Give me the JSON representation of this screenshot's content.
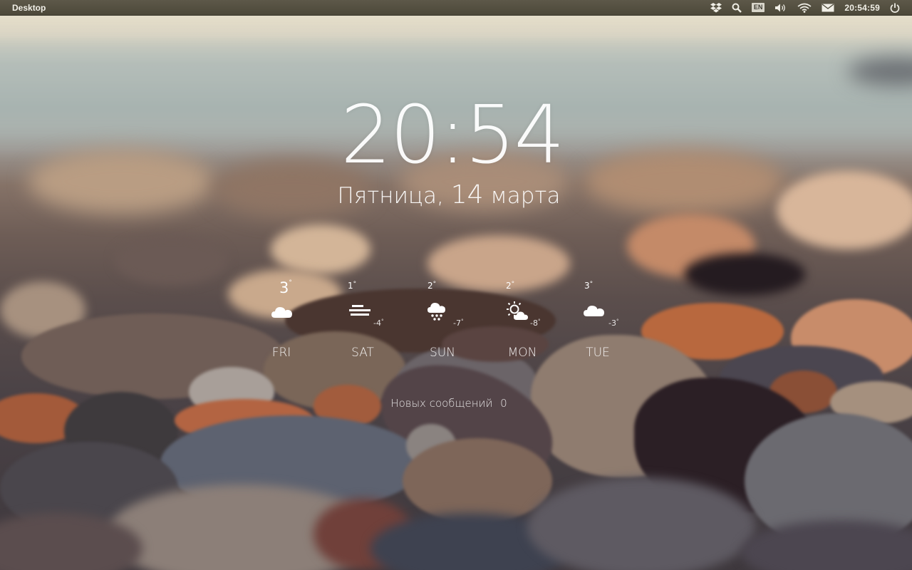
{
  "panel": {
    "title": "Desktop",
    "indicators": {
      "dropbox_icon": "dropbox-icon",
      "search_icon": "search-icon",
      "keyboard_layout": "EN",
      "volume_icon": "volume-icon",
      "wifi_icon": "wifi-icon",
      "mail_icon": "mail-icon",
      "clock": "20:54:59",
      "power_icon": "power-icon"
    }
  },
  "widget": {
    "time": "20:54",
    "date": {
      "weekday": "Пятница,",
      "day": "14",
      "month": "марта"
    },
    "forecast": [
      {
        "day": "FRI",
        "high": "3",
        "low": "",
        "icon": "cloud-icon"
      },
      {
        "day": "SAT",
        "high": "1",
        "low": "-4",
        "icon": "fog-icon"
      },
      {
        "day": "SUN",
        "high": "2",
        "low": "-7",
        "icon": "snow-cloud-icon"
      },
      {
        "day": "MON",
        "high": "2",
        "low": "-8",
        "icon": "partly-sunny-icon"
      },
      {
        "day": "TUE",
        "high": "3",
        "low": "-3",
        "icon": "cloud-icon"
      }
    ],
    "messages": {
      "label": "Новых сообщений",
      "count": "0"
    }
  },
  "colors": {
    "panel_bg": "#54503f",
    "text": "#ffffff"
  }
}
